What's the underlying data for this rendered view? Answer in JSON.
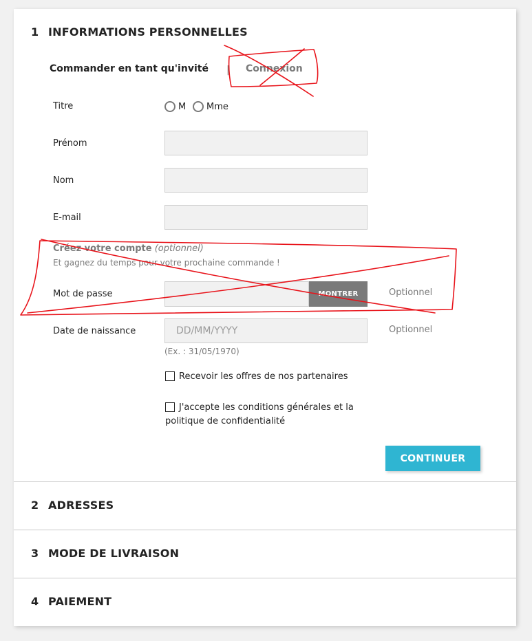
{
  "steps": [
    {
      "number": "1",
      "title": "INFORMATIONS PERSONNELLES"
    },
    {
      "number": "2",
      "title": "ADRESSES"
    },
    {
      "number": "3",
      "title": "MODE DE LIVRAISON"
    },
    {
      "number": "4",
      "title": "PAIEMENT"
    }
  ],
  "tabs": {
    "guest": "Commander en tant qu'invité",
    "divider": "|",
    "login": "Connexion"
  },
  "form": {
    "title_label": "Titre",
    "title_options": [
      "M",
      "Mme"
    ],
    "firstname_label": "Prénom",
    "lastname_label": "Nom",
    "email_label": "E-mail",
    "create_account_title": "Créez votre compte",
    "create_account_optional": "(optionnel)",
    "create_account_sub": "Et gagnez du temps pour votre prochaine commande !",
    "password_label": "Mot de passe",
    "show_button": "MONTRER",
    "optional_text": "Optionnel",
    "birthdate_label": "Date de naissance",
    "birthdate_placeholder": "DD/MM/YYYY",
    "birthdate_hint": "(Ex. : 31/05/1970)",
    "partner_offers": "Recevoir les offres de nos partenaires",
    "terms": "J'accepte les conditions générales et la politique de confidentialité",
    "continue_button": "CONTINUER"
  },
  "colors": {
    "accent": "#2fb5d2",
    "annotation": "#e8141b",
    "muted": "#7a7a7a"
  }
}
